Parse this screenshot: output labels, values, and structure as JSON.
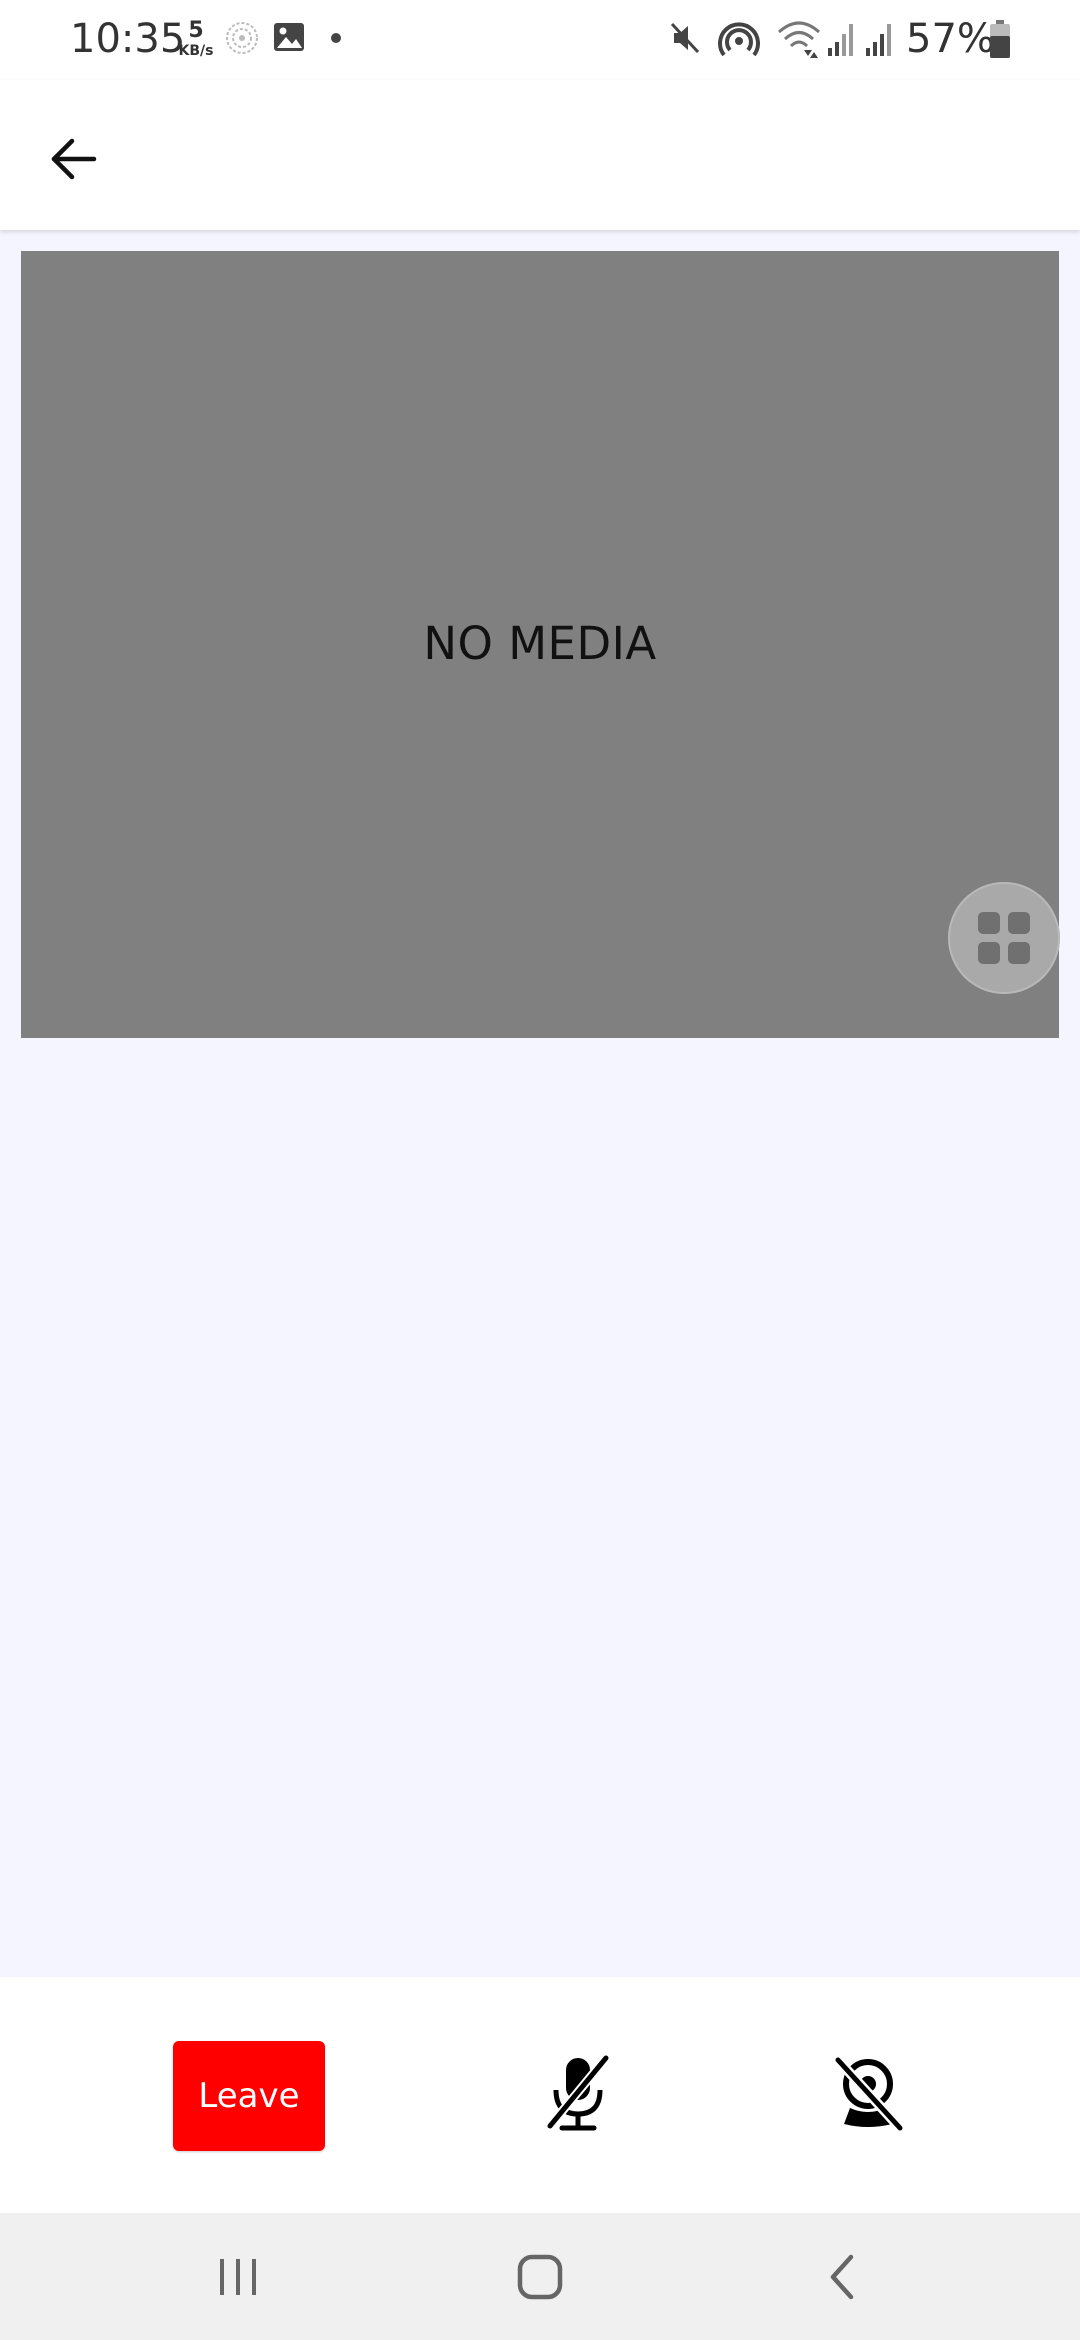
{
  "status_bar": {
    "time": "10:35",
    "speed_value": "5",
    "speed_unit": "KB/s",
    "battery_percent": "57%",
    "icons": [
      "vpn-icon",
      "gallery-icon",
      "dot-icon",
      "mute-icon",
      "hotspot-icon",
      "wifi-icon",
      "signal-icon",
      "signal-icon",
      "battery-icon"
    ]
  },
  "app_bar": {
    "back_icon": "arrow-left-icon"
  },
  "video_tile": {
    "placeholder_text": "NO MEDIA",
    "layout_icon": "grid-icon",
    "background_color": "#808080"
  },
  "controls": {
    "leave_label": "Leave",
    "leave_color": "#ff0000",
    "mic_icon": "mic-off-icon",
    "camera_icon": "camera-off-icon"
  },
  "nav_bar": {
    "recents_icon": "recents-icon",
    "home_icon": "home-icon",
    "back_icon": "back-icon"
  }
}
